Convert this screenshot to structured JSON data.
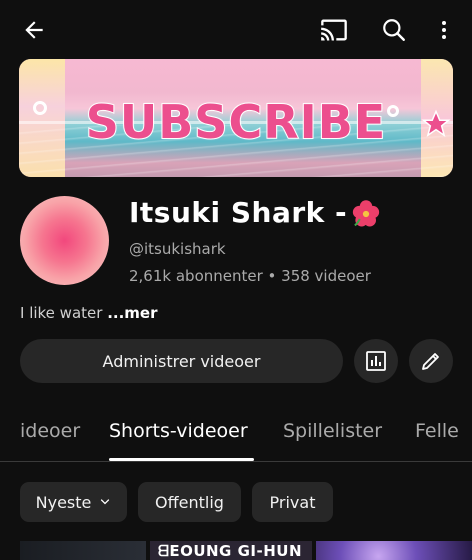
{
  "banner": {
    "title": "SUBSCRIBE"
  },
  "channel": {
    "name": "Itsuki Shark -",
    "handle": "@itsukishark",
    "stats": "2,61k abonnenter • 358 videoer",
    "description": "I like water ",
    "description_more": "...mer"
  },
  "actions": {
    "manage_label": "Administrer videoer"
  },
  "tabs": [
    {
      "label": "ideoer"
    },
    {
      "label": "Shorts-videoer"
    },
    {
      "label": "Spillelister"
    },
    {
      "label": "Felle"
    }
  ],
  "chips": {
    "newest": "Nyeste",
    "public": "Offentlig",
    "private": "Privat"
  },
  "thumbnails": {
    "second_text": "ᗺEOUNG GI-HUN"
  },
  "icons": {
    "back": "arrow-back-icon",
    "cast": "cast-icon",
    "search": "search-icon",
    "more": "more-vert-icon",
    "stats": "bar-chart-icon",
    "edit": "pencil-icon",
    "chevron": "chevron-down-icon",
    "flower": "hibiscus-icon"
  },
  "colors": {
    "background": "#0f0f0f",
    "surface": "#272727",
    "banner_pink": "#ec4f8e"
  }
}
